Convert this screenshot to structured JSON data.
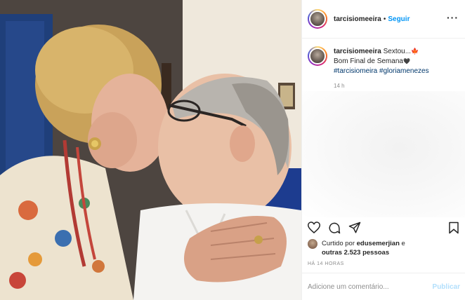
{
  "post": {
    "username": "tarcisiomeeira",
    "follow_label": "Seguir",
    "separator": "•",
    "more_label": "···"
  },
  "caption": {
    "username": "tarcisiomeeira",
    "line1": "Sextou...",
    "line2": "Bom Final de Semana",
    "heart": "🖤",
    "leaf": "🍁",
    "hashtags": "#tarcisiomeira #gloriamenezes",
    "time": "14 h"
  },
  "likes": {
    "prefix": "Curtido por",
    "user": "edusemerjian",
    "conj": "e",
    "others": "outras 2.523 pessoas"
  },
  "timestamp": "HÁ 14 HORAS",
  "comment": {
    "placeholder": "Adicione um comentário...",
    "publish_label": "Publicar"
  },
  "icons": {
    "like": "heart-icon",
    "comment": "comment-icon",
    "share": "share-icon",
    "save": "bookmark-icon"
  }
}
